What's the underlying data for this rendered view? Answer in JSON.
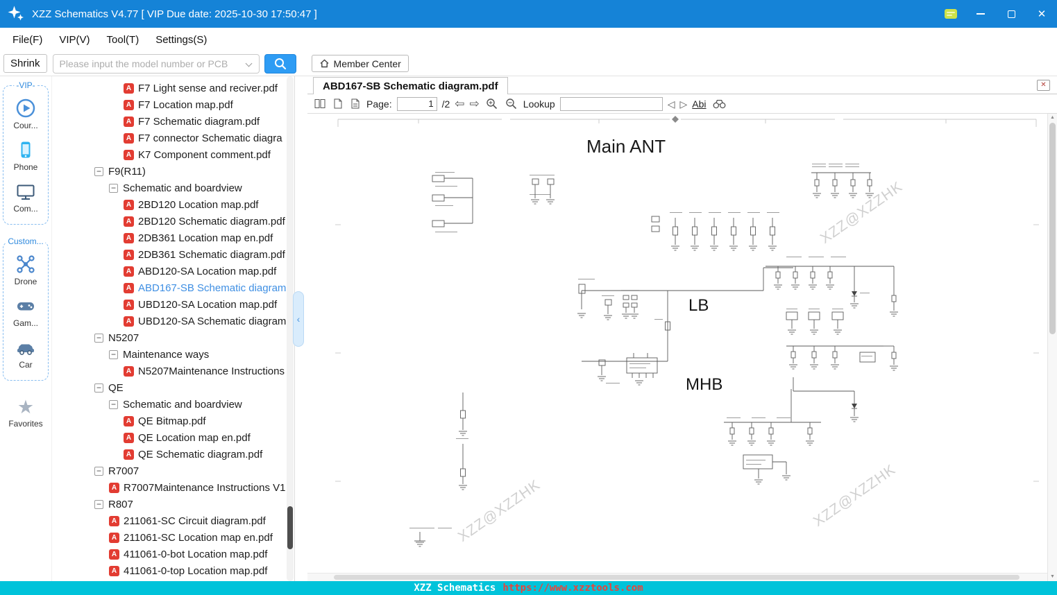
{
  "window": {
    "title": "XZZ Schematics V4.77 [ VIP Due date: 2025-10-30 17:50:47 ]"
  },
  "colors": {
    "titlebar": "#1583d7",
    "accent_blue": "#2e9cf4",
    "statusbar_cyan": "#00c3da",
    "pdf_icon_red": "#e23c32",
    "selected_tree_text": "#3f8fe3"
  },
  "icons": {
    "app_logo": "white sparkle star",
    "vip_card": "lime badge",
    "minimize": "dash",
    "maximize": "square outline",
    "close": "x",
    "search": "magnifier",
    "search_dropdown": "chevron-down",
    "member_center": "house",
    "pdf_file": "red A badge",
    "tree_collapse": "box-minus",
    "two_page_view": "double pages",
    "fit_page": "document",
    "fit_width": "document with lines",
    "prev_page": "hollow left arrow",
    "next_page": "hollow right arrow",
    "zoom_in": "magnifier plus",
    "zoom_out": "magnifier minus",
    "find_prev": "left triangle",
    "find_next": "right triangle",
    "text_select": "Abi underlined",
    "binoculars": "binoculars",
    "close_tab": "boxed x",
    "collapse_panel": "left chevron",
    "sidebar": [
      "play-circle",
      "phone",
      "computer",
      "drone",
      "gamepad",
      "car",
      "star"
    ]
  },
  "menu": {
    "items": [
      {
        "id": "file",
        "label": "File(F)"
      },
      {
        "id": "vip",
        "label": "VIP(V)"
      },
      {
        "id": "tool",
        "label": "Tool(T)"
      },
      {
        "id": "settings",
        "label": "Settings(S)"
      }
    ]
  },
  "toolbar": {
    "shrink": "Shrink",
    "search_placeholder": "Please input the model number or PCB",
    "member_center": "Member Center"
  },
  "sidebar": {
    "vip_label": "-VIP-",
    "custom_label": "Custom...",
    "items": [
      {
        "label": "Cour..."
      },
      {
        "label": "Phone"
      },
      {
        "label": "Com..."
      },
      {
        "label": "Drone"
      },
      {
        "label": "Gam..."
      },
      {
        "label": "Car"
      },
      {
        "label": "Favorites"
      }
    ]
  },
  "tree": {
    "items": [
      {
        "label": "F7 Light sense and reciver.pdf",
        "level": 3,
        "type": "pdf"
      },
      {
        "label": "F7 Location map.pdf",
        "level": 3,
        "type": "pdf"
      },
      {
        "label": "F7 Schematic diagram.pdf",
        "level": 3,
        "type": "pdf"
      },
      {
        "label": "F7 connector Schematic diagra",
        "level": 3,
        "type": "pdf"
      },
      {
        "label": "K7 Component comment.pdf",
        "level": 3,
        "type": "pdf"
      },
      {
        "label": "F9(R11)",
        "level": 1,
        "type": "node"
      },
      {
        "label": "Schematic and boardview",
        "level": 2,
        "type": "node"
      },
      {
        "label": "2BD120 Location map.pdf",
        "level": 3,
        "type": "pdf"
      },
      {
        "label": "2BD120 Schematic diagram.pdf",
        "level": 3,
        "type": "pdf"
      },
      {
        "label": "2DB361 Location map en.pdf",
        "level": 3,
        "type": "pdf"
      },
      {
        "label": "2DB361 Schematic diagram.pdf",
        "level": 3,
        "type": "pdf"
      },
      {
        "label": "ABD120-SA Location map.pdf",
        "level": 3,
        "type": "pdf"
      },
      {
        "label": "ABD167-SB Schematic diagram",
        "level": 3,
        "type": "pdf",
        "selected": true
      },
      {
        "label": "UBD120-SA Location map.pdf",
        "level": 3,
        "type": "pdf"
      },
      {
        "label": "UBD120-SA Schematic diagram",
        "level": 3,
        "type": "pdf"
      },
      {
        "label": "N5207",
        "level": 1,
        "type": "node"
      },
      {
        "label": "Maintenance ways",
        "level": 2,
        "type": "node"
      },
      {
        "label": "N5207Maintenance Instructions",
        "level": 3,
        "type": "pdf"
      },
      {
        "label": "QE",
        "level": 1,
        "type": "node"
      },
      {
        "label": "Schematic and boardview",
        "level": 2,
        "type": "node"
      },
      {
        "label": "QE Bitmap.pdf",
        "level": 3,
        "type": "pdf"
      },
      {
        "label": "QE Location map en.pdf",
        "level": 3,
        "type": "pdf"
      },
      {
        "label": "QE Schematic diagram.pdf",
        "level": 3,
        "type": "pdf"
      },
      {
        "label": "R7007",
        "level": 1,
        "type": "node"
      },
      {
        "label": "R7007Maintenance Instructions V1",
        "level": 2,
        "type": "pdf"
      },
      {
        "label": "R807",
        "level": 1,
        "type": "node"
      },
      {
        "label": "211061-SC Circuit diagram.pdf",
        "level": 2,
        "type": "pdf"
      },
      {
        "label": "211061-SC Location map en.pdf",
        "level": 2,
        "type": "pdf"
      },
      {
        "label": "411061-0-bot Location map.pdf",
        "level": 2,
        "type": "pdf"
      },
      {
        "label": "411061-0-top Location map.pdf",
        "level": 2,
        "type": "pdf"
      }
    ]
  },
  "viewer": {
    "tab_title": "ABD167-SB Schematic diagram.pdf"
  },
  "pdf_toolbar": {
    "page_label": "Page:",
    "page_value": "1",
    "page_total": "/2",
    "lookup_label": "Lookup",
    "lookup_value": "",
    "text_select_label": "Abi"
  },
  "schematic": {
    "title": "Main ANT",
    "section_labels": [
      "LB",
      "MHB"
    ],
    "watermark": "XZZ@XZZHK"
  },
  "statusbar": {
    "app_name": "XZZ Schematics",
    "url": "https://www.xzztools.com"
  }
}
